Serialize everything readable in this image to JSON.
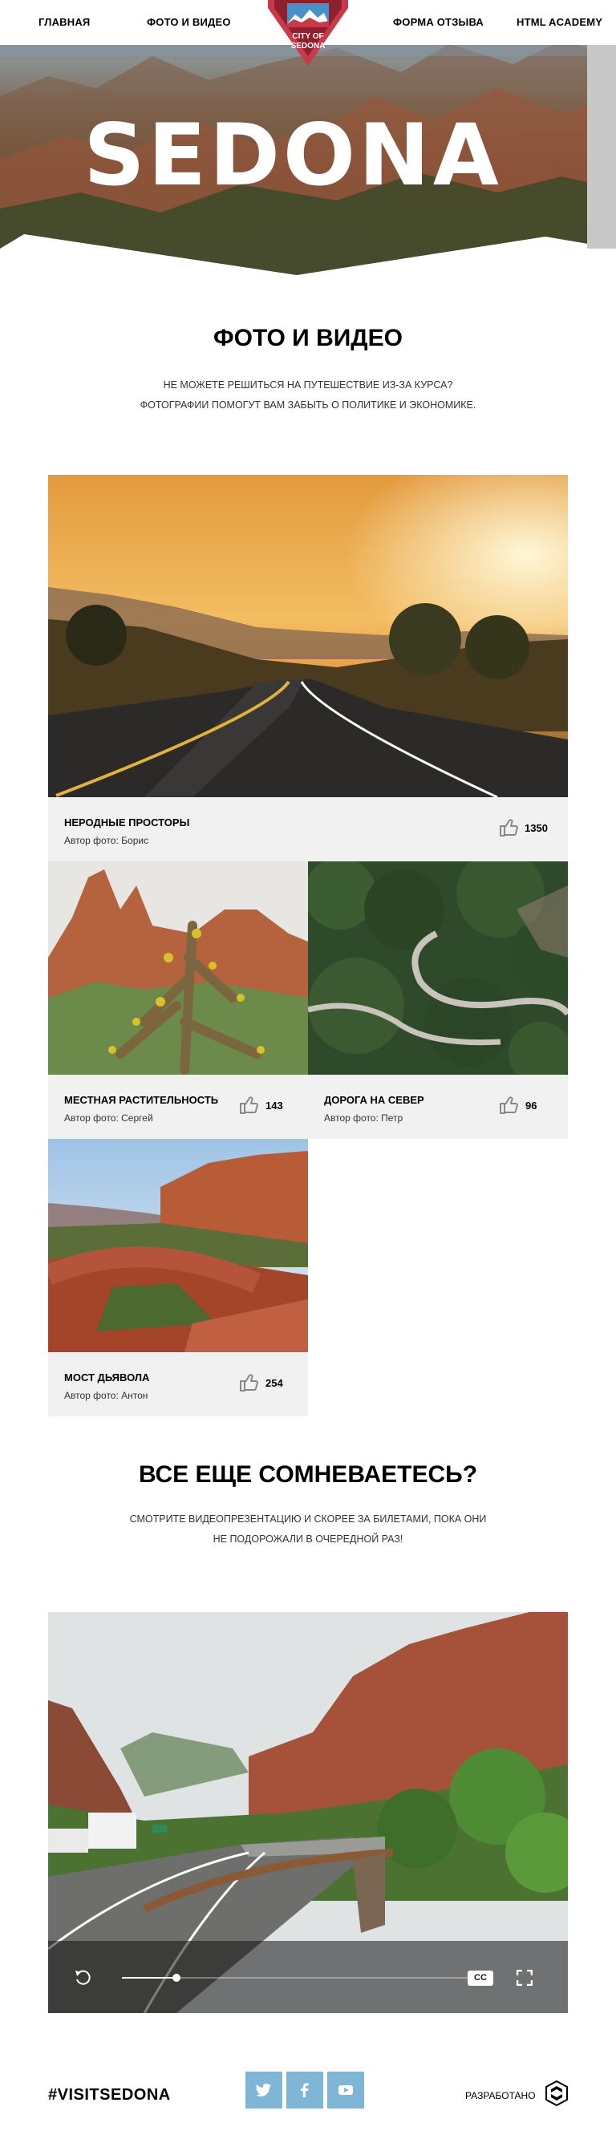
{
  "nav": {
    "items": [
      "ГЛАВНАЯ",
      "ФОТО И ВИДЕО",
      "ФОРМА ОТЗЫВА",
      "HTML ACADEMY"
    ],
    "logo_text": "CITY OF SEDONA"
  },
  "hero": {
    "title": "SEDONA"
  },
  "gallery_section": {
    "title": "ФОТО И ВИДЕО",
    "subtitle_line1": "НЕ МОЖЕТЕ РЕШИТЬСЯ НА ПУТЕШЕСТВИЕ ИЗ-ЗА КУРСА?",
    "subtitle_line2": "ФОТОГРАФИИ ПОМОГУТ ВАМ ЗАБЫТЬ О ПОЛИТИКЕ И ЭКОНОМИКЕ."
  },
  "photos": [
    {
      "title": "НЕРОДНЫЕ ПРОСТОРЫ",
      "author": "Автор фото: Борис",
      "likes": "1350",
      "icon": "thumbs-up-icon"
    },
    {
      "title": "МЕСТНАЯ РАСТИТЕЛЬНОСТЬ",
      "author": "Автор фото: Сергей",
      "likes": "143",
      "icon": "thumbs-up-icon"
    },
    {
      "title": "ДОРОГА НА СЕВЕР",
      "author": "Автор фото: Петр",
      "likes": "96",
      "icon": "thumbs-up-icon"
    },
    {
      "title": "МОСТ ДЬЯВОЛА",
      "author": "Автор фото: Антон",
      "likes": "254",
      "icon": "thumbs-up-icon"
    }
  ],
  "video_section": {
    "title": "ВСЕ ЕЩЕ СОМНЕВАЕТЕСЬ?",
    "subtitle_line1": "СМОТРИТЕ ВИДЕОПРЕЗЕНТАЦИЮ И СКОРЕЕ ЗА БИЛЕТАМИ, ПОКА ОНИ",
    "subtitle_line2": "НЕ ПОДОРОЖАЛИ В ОЧЕРЕДНОЙ РАЗ!"
  },
  "video_player": {
    "progress": 0.15,
    "cc_label": "CC",
    "icons": [
      "replay-icon",
      "fullscreen-icon"
    ]
  },
  "footer": {
    "hashtag": "#VISITSEDONA",
    "social": [
      "twitter-icon",
      "facebook-icon",
      "youtube-icon"
    ],
    "developed_by": "РАЗРАБОТАНО",
    "accent_color": "#7fb6d8"
  }
}
